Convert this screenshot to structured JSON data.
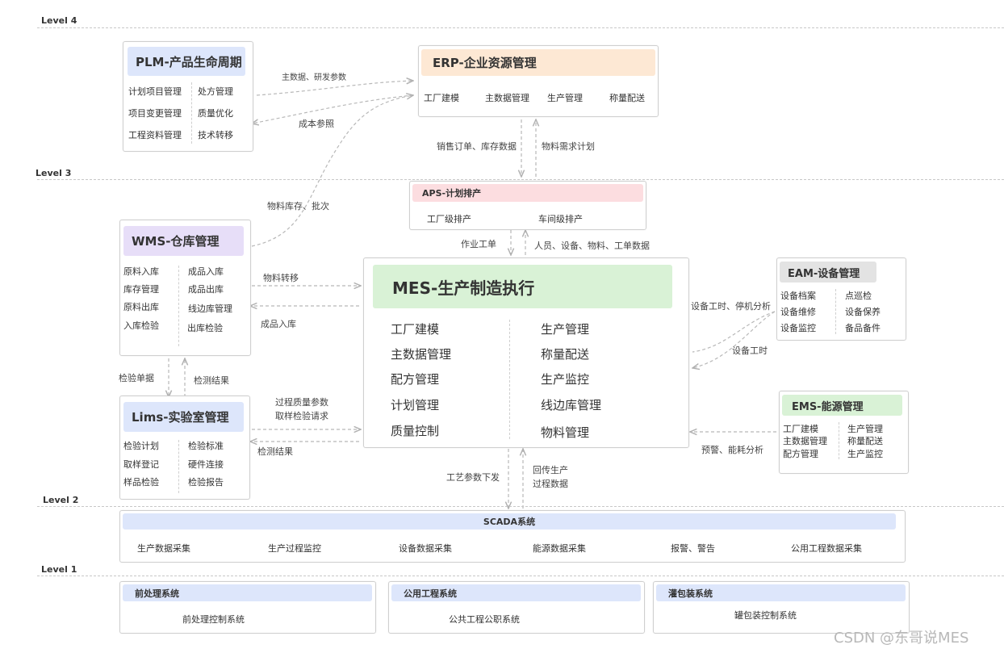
{
  "levels": [
    "Level 4",
    "Level 3",
    "Level 2",
    "Level 1"
  ],
  "plm": {
    "title": "PLM-产品生命周期",
    "left": [
      "计划项目管理",
      "项目变更管理",
      "工程资料管理"
    ],
    "right": [
      "处方管理",
      "质量优化",
      "技术转移"
    ]
  },
  "erp": {
    "title": "ERP-企业资源管理",
    "items": [
      "工厂建模",
      "主数据管理",
      "生产管理",
      "称量配送"
    ]
  },
  "aps": {
    "title": "APS-计划排产",
    "items": [
      "工厂级排产",
      "车间级排产"
    ]
  },
  "wms": {
    "title": "WMS-仓库管理",
    "left": [
      "原料入库",
      "库存管理",
      "原料出库",
      "入库检验"
    ],
    "right": [
      "成品入库",
      "成品出库",
      "线边库管理",
      "出库检验"
    ]
  },
  "lims": {
    "title": "Lims-实验室管理",
    "left": [
      "检验计划",
      "取样登记",
      "样品检验"
    ],
    "right": [
      "检验标准",
      "硬件连接",
      "检验报告"
    ]
  },
  "mes": {
    "title": "MES-生产制造执行",
    "left": [
      "工厂建模",
      "主数据管理",
      "配方管理",
      "计划管理",
      "质量控制"
    ],
    "right": [
      "生产管理",
      "称量配送",
      "生产监控",
      "线边库管理",
      "物料管理"
    ]
  },
  "eam": {
    "title": "EAM-设备管理",
    "left": [
      "设备档案",
      "设备维修",
      "设备监控"
    ],
    "right": [
      "点巡检",
      "设备保养",
      "备品备件"
    ]
  },
  "ems": {
    "title": "EMS-能源管理",
    "left": [
      "工厂建模",
      "主数据管理",
      "配方管理"
    ],
    "right": [
      "生产管理",
      "称量配送",
      "生产监控"
    ]
  },
  "scada": {
    "title": "SCADA系统",
    "items": [
      "生产数据采集",
      "生产过程监控",
      "设备数据采集",
      "能源数据采集",
      "报警、警告",
      "公用工程数据采集"
    ]
  },
  "l1": [
    {
      "title": "前处理系统",
      "item": "前处理控制系统"
    },
    {
      "title": "公用工程系统",
      "item": "公共工程公职系统"
    },
    {
      "title": "灌包装系统",
      "item": "罐包装控制系统"
    }
  ],
  "arrows": {
    "plm_to_erp": "主数据、研发参数",
    "erp_to_plm": "成本参照",
    "erp_to_aps_left": "销售订单、库存数据",
    "aps_to_erp": "物料需求计划",
    "wms_to_erp": "物料库存、批次",
    "aps_to_mes": "作业工单",
    "mes_to_aps": "人员、设备、物料、工单数据",
    "wms_to_mes": "物料转移",
    "mes_to_wms": "成品入库",
    "wms_to_lims": "检验单据",
    "lims_to_wms": "检测结果",
    "lims_to_mes_1": "过程质量参数",
    "lims_to_mes_2": "取样检验请求",
    "mes_to_lims": "检测结果",
    "eam_to_mes_1": "设备工时、停机分析",
    "eam_to_mes_2": "设备工时",
    "ems_to_mes": "预警、能耗分析",
    "mes_to_scada": "工艺参数下发",
    "scada_to_mes_1": "回传生产",
    "scada_to_mes_2": "过程数据"
  },
  "watermark": "CSDN @东哥说MES",
  "colors": {
    "plm": "#dde6fb",
    "erp": "#fde8d4",
    "aps": "#fcdde0",
    "wms": "#e7def8",
    "lims": "#dde6fb",
    "mes": "#d9f2d6",
    "eam": "#e3e3e3",
    "ems": "#d9f2d6",
    "scada": "#dde6fb",
    "l1": "#dde6fb"
  }
}
